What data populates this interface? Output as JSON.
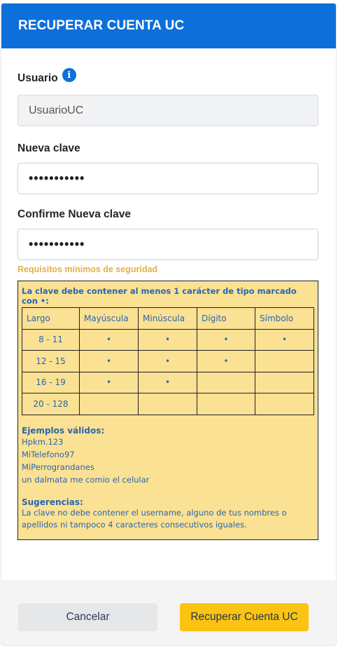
{
  "header": {
    "title": "RECUPERAR CUENTA UC"
  },
  "form": {
    "username": {
      "label": "Usuario",
      "value": "UsuarioUC",
      "info_icon": "info-icon"
    },
    "new_password": {
      "label": "Nueva clave",
      "value": "•••••••••••"
    },
    "confirm_password": {
      "label": "Confirme Nueva clave",
      "value": "•••••••••••"
    }
  },
  "requirements": {
    "title": "Requisitos mínimos de seguridad",
    "heading": "La clave debe contener al menos 1 carácter de tipo marcado con •:",
    "columns": [
      "Largo",
      "Mayúscula",
      "Minúscula",
      "Dígito",
      "Símbolo"
    ],
    "rows": [
      [
        "8 - 11",
        "•",
        "•",
        "•",
        "•"
      ],
      [
        "12 - 15",
        "•",
        "•",
        "•",
        ""
      ],
      [
        "16 - 19",
        "•",
        "•",
        "",
        ""
      ],
      [
        "20 - 128",
        "",
        "",
        "",
        ""
      ]
    ],
    "examples_title": "Ejemplos válidos:",
    "examples": [
      "Hpkm.123",
      "MiTelefono97",
      "MiPerrograndanes",
      "un dalmata me comio el celular"
    ],
    "suggestions_title": "Sugerencias:",
    "suggestions_text": "La clave no debe contener el username, alguno de tus nombres o apellidos ni tampoco 4 caracteres consecutivos iguales."
  },
  "footer": {
    "cancel_label": "Cancelar",
    "submit_label": "Recuperar Cuenta UC"
  },
  "colors": {
    "header": "#0d6fd9",
    "req_box": "#fbe193",
    "req_text": "#2866b0",
    "submit": "#fbc312"
  }
}
